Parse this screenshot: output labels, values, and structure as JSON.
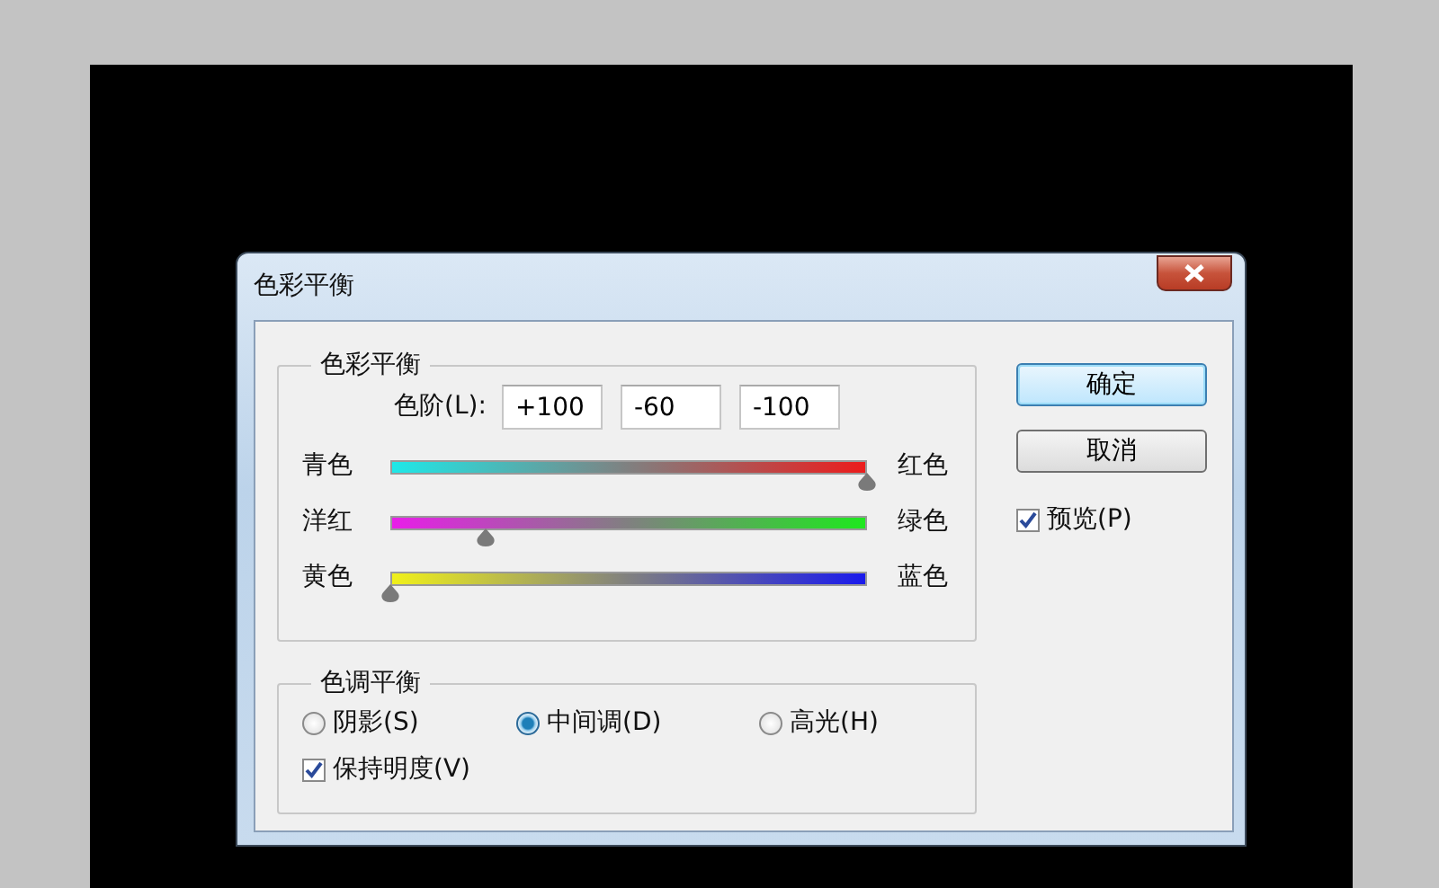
{
  "window": {
    "title": "色彩平衡"
  },
  "color_balance": {
    "legend": "色彩平衡",
    "levels_label": "色阶(L):",
    "levels": [
      "+100",
      "-60",
      "-100"
    ],
    "sliders": [
      {
        "ends": [
          {
            "label": "青色",
            "color": "#1ee8e8"
          },
          {
            "label": "红色",
            "color": "#ec1c1c"
          }
        ],
        "level": 1.0
      },
      {
        "ends": [
          {
            "label": "洋红",
            "color": "#e81ee8"
          },
          {
            "label": "绿色",
            "color": "#1ee81e"
          }
        ],
        "level": 0.2
      },
      {
        "ends": [
          {
            "label": "黄色",
            "color": "#f0f01a"
          },
          {
            "label": "蓝色",
            "color": "#1a1aec"
          }
        ],
        "level": 0.0
      }
    ]
  },
  "tone_balance": {
    "legend": "色调平衡",
    "options": [
      {
        "label": "阴影(S)",
        "selected": false
      },
      {
        "label": "中间调(D)",
        "selected": true
      },
      {
        "label": "高光(H)",
        "selected": false
      }
    ],
    "preserve_luminosity": {
      "label": "保持明度(V)",
      "checked": true
    }
  },
  "buttons": [
    {
      "label": "确定",
      "default": true
    },
    {
      "label": "取消",
      "default": false
    }
  ],
  "preview": {
    "label": "预览(P)",
    "checked": true
  }
}
